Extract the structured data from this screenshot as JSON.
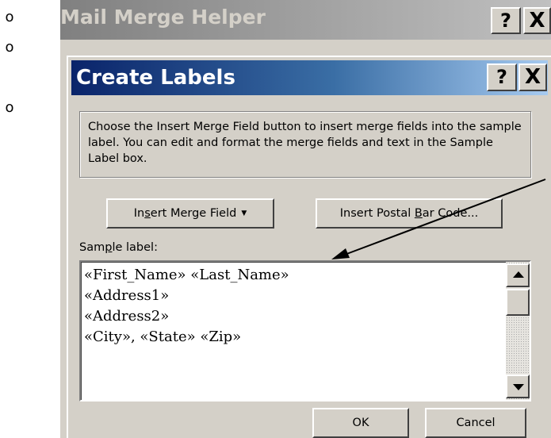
{
  "bullets": [
    "o",
    "o",
    "o"
  ],
  "back_dialog": {
    "title": "Mail Merge Helper",
    "help_label": "?",
    "close_label": "X"
  },
  "dialog": {
    "title": "Create Labels",
    "help_label": "?",
    "close_label": "X",
    "instructions": "Choose the Insert Merge Field button to insert merge fields into the sample label.  You can edit and format the merge fields and text in the Sample Label box.",
    "insert_merge_field": {
      "label_a": "In",
      "accel": "s",
      "label_b": "ert Merge Field"
    },
    "insert_postal_bar_code": {
      "label_a": "Insert Postal ",
      "accel": "B",
      "label_b": "ar Code..."
    },
    "sample_label": {
      "label_a": "Sam",
      "accel": "p",
      "label_b": "le label:"
    },
    "sample_lines": [
      "«First_Name» «Last_Name»",
      "«Address1»",
      "«Address2»",
      "«City», «State»  «Zip»"
    ],
    "ok_label": "OK",
    "cancel_label": "Cancel"
  },
  "icons": {
    "dropdown_arrow": "▼"
  }
}
